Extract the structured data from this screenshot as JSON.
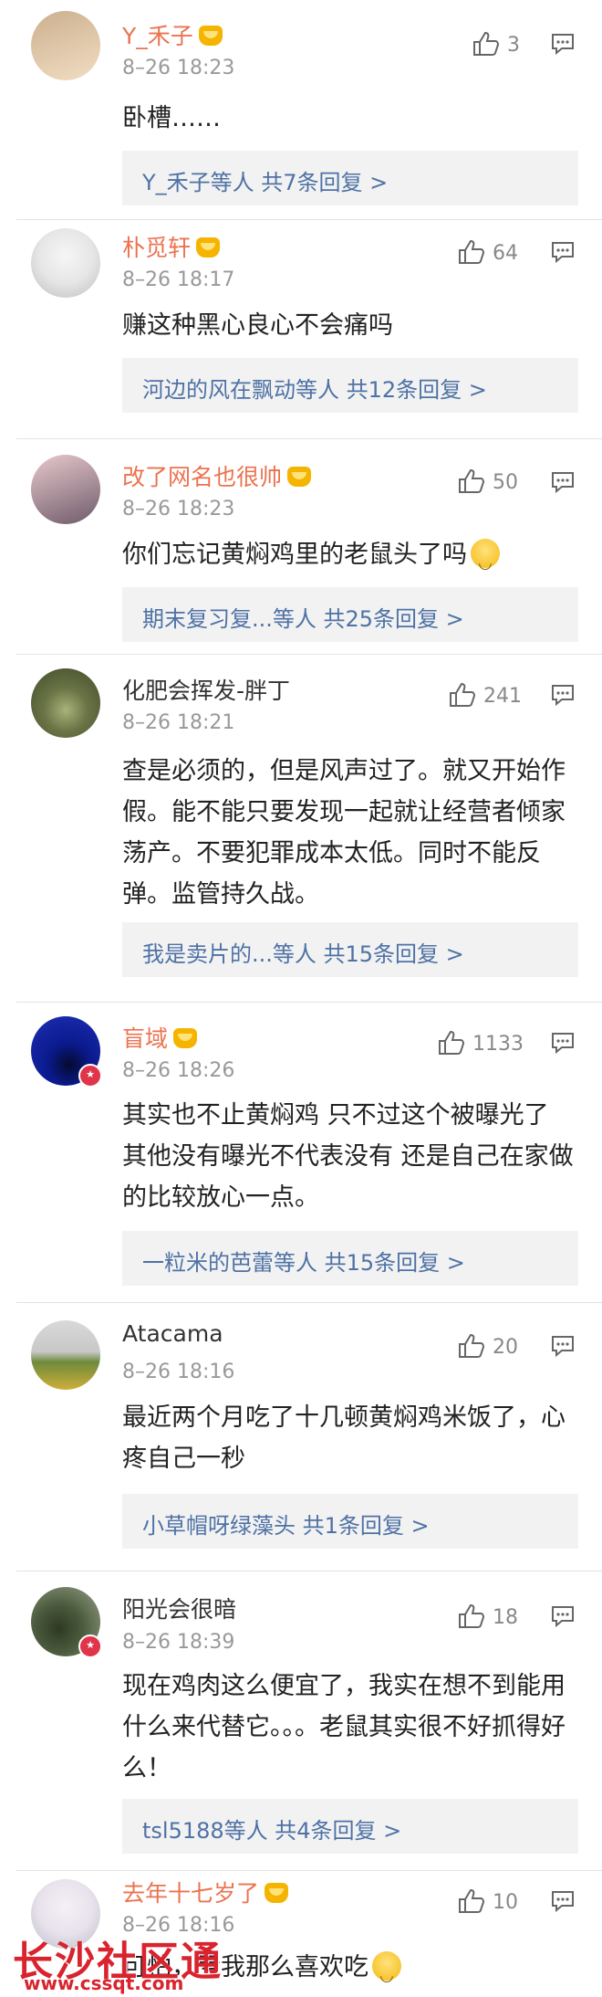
{
  "comments": [
    {
      "user": "Y_禾子",
      "time": "8–26 18:23",
      "likes": "3",
      "text": "卧槽……",
      "replies": "Y_禾子等人  共7条回复 >",
      "colors": [
        "#cbb08e",
        "#f2ddc3"
      ]
    },
    {
      "user": "朴觅轩",
      "time": "8–26 18:17",
      "likes": "64",
      "text": "赚这种黑心良心不会痛吗",
      "replies": "河边的风在飘动等人  共12条回复 >",
      "colors": [
        "#e6e6e6",
        "#bdbdbd"
      ]
    },
    {
      "user": "改了网名也很帅",
      "time": "8–26 18:23",
      "likes": "50",
      "text": "你们忘记黄焖鸡里的老鼠头了吗",
      "replies": "期末复习复...等人  共25条回复 >",
      "colors": [
        "#e8c9cc",
        "#6f5b6b"
      ]
    },
    {
      "user": "化肥会挥发-胖丁",
      "time": "8–26 18:21",
      "likes": "241",
      "text": "查是必须的，但是风声过了。就又开始作假。能不能只要发现一起就让经营者倾家荡产。不要犯罪成本太低。同时不能反弹。监管持久战。",
      "replies": "我是卖片的...等人  共15条回复 >",
      "colors": [
        "#3f4a2c",
        "#a8b27a"
      ]
    },
    {
      "user": "盲域",
      "time": "8–26 18:26",
      "likes": "1133",
      "text": "其实也不止黄焖鸡 只不过这个被曝光了 其他没有曝光不代表没有 还是自己在家做的比较放心一点。",
      "replies": "一粒米的芭蕾等人  共15条回复 >",
      "colors": [
        "#0a1a8c",
        "#1f2fb8"
      ]
    },
    {
      "user": "Atacama",
      "time": "8–26 18:16",
      "likes": "20",
      "text": "最近两个月吃了十几顿黄焖鸡米饭了，心疼自己一秒",
      "replies": "小草帽呀绿藻头  共1条回复 >",
      "colors": [
        "#c8c8c8",
        "#6e8a3a"
      ]
    },
    {
      "user": "阳光会很暗",
      "time": "8–26 18:39",
      "likes": "18",
      "text": "现在鸡肉这么便宜了，我实在想不到能用什么来代替它。。。老鼠其实很不好抓得好么！",
      "replies": "tsl5188等人  共4条回复 >",
      "colors": [
        "#4a5a3c",
        "#9aa28a"
      ]
    },
    {
      "user": "去年十七岁了",
      "time": "8–26 18:16",
      "likes": "10",
      "text": "可怕，亏我那么喜欢吃",
      "replies": "",
      "colors": [
        "#e8e2ec",
        "#b9bdc9"
      ]
    }
  ],
  "watermark": {
    "title": "长沙社区通",
    "url": "www.cssqt.com"
  }
}
